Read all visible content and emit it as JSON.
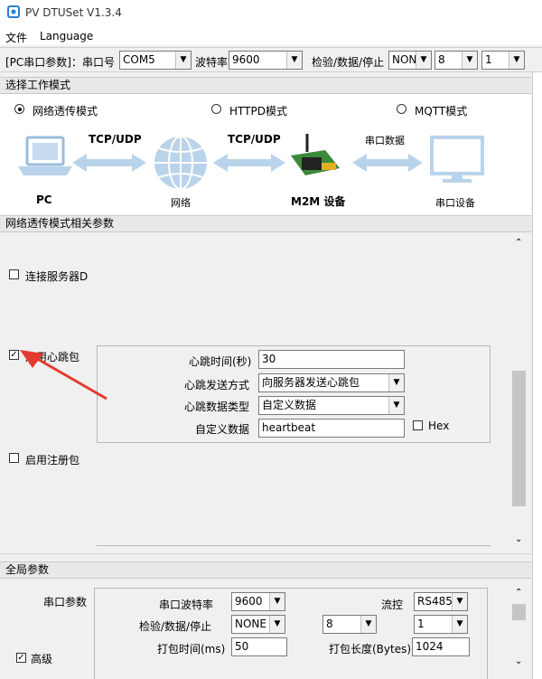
{
  "window": {
    "title": "PV DTUSet V1.3.4"
  },
  "menu": {
    "file": "文件",
    "language": "Language"
  },
  "toolbar": {
    "pc_serial_label": "[PC串口参数]：串口号",
    "com_port": "COM5",
    "baud_label": "波特率",
    "baud": "9600",
    "parity_label": "检验/数据/停止",
    "parity": "NONI",
    "data_bits": "8",
    "stop_bits": "1"
  },
  "mode": {
    "section_title": "选择工作模式",
    "options": [
      "网络透传模式",
      "HTTPD模式",
      "MQTT模式"
    ],
    "selected": "网络透传模式"
  },
  "diagram": {
    "pc_label": "PC",
    "link1": "TCP/UDP",
    "network_label": "网络",
    "link2": "TCP/UDP",
    "m2m_label": "M2M 设备",
    "link3": "串口数据",
    "serial_device_label": "串口设备"
  },
  "params": {
    "section_title": "网络透传模式相关参数",
    "connect_server": "连接服务器D",
    "heartbeat_enable": "启用心跳包",
    "heartbeat_checked": true,
    "heartbeat_time_label": "心跳时间(秒)",
    "heartbeat_time": "30",
    "send_mode_label": "心跳发送方式",
    "send_mode": "向服务器发送心跳包",
    "data_type_label": "心跳数据类型",
    "data_type": "自定义数据",
    "custom_data_label": "自定义数据",
    "custom_data": "heartbeat",
    "hex_label": "Hex",
    "register_enable": "启用注册包"
  },
  "global": {
    "section_title": "全局参数",
    "serial_params_label": "串口参数",
    "baud_label": "串口波特率",
    "baud": "9600",
    "flow_label": "流控",
    "flow": "RS485",
    "parity_label": "检验/数据/停止",
    "parity": "NONE",
    "data_bits": "8",
    "stop_bits": "1",
    "pack_time_label": "打包时间(ms)",
    "pack_time": "50",
    "pack_len_label": "打包长度(Bytes)",
    "pack_len": "1024",
    "advanced_label": "高级",
    "advanced_checked": true
  },
  "colors": {
    "accent": "#2a7fd4",
    "arrow": "#e53a2f",
    "diagram_blue": "#b9d3ea"
  }
}
